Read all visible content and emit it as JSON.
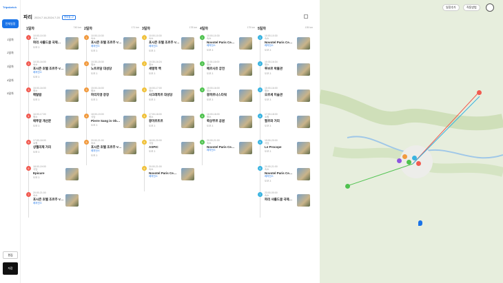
{
  "app": {
    "logo": "Tripsketch",
    "title": "파리",
    "dates": "2024.7.16-2024.7.20",
    "chip": "편의점 ⇄",
    "sidebar": [
      "전체일정",
      "1일차",
      "2일차",
      "3일차",
      "4일차",
      "5일차"
    ],
    "edit": "편집",
    "save": "저장"
  },
  "map": {
    "buttons": [
      "일정추가",
      "직동방법"
    ]
  },
  "days": [
    {
      "label": "1일차",
      "dist": "740 km",
      "stops": [
        {
          "n": "1",
          "color": "#f15a50",
          "time": "10:00-10:30",
          "cat": "숙소",
          "name": "파리 샤를드골 국제…",
          "sub": "",
          "next": "도보 3"
        },
        {
          "n": "2",
          "color": "#f15a50",
          "time": "10:30-16:00",
          "cat": "숙소",
          "name": "포시즌 호텔 조르주 V…",
          "sub": "레지던스",
          "next": "도보 3"
        },
        {
          "n": "3",
          "color": "#f15a50",
          "time": "15:00-16:00",
          "cat": "명소",
          "name": "메탈람",
          "sub": "",
          "next": "도보 3"
        },
        {
          "n": "4",
          "color": "#f15a50",
          "time": "16:00-17:00",
          "cat": "명소",
          "name": "에투알 개선문",
          "sub": "",
          "next": "도보 3"
        },
        {
          "n": "5",
          "color": "#f15a50",
          "time": "17:00-18:00",
          "cat": "쇼핑",
          "name": "샹젤리제 거리",
          "sub": "",
          "next": "도보 3"
        },
        {
          "n": "6",
          "color": "#f15a50",
          "time": "18:00-19:00",
          "cat": "식당",
          "name": "Epicure",
          "sub": "",
          "next": "도보 3"
        },
        {
          "n": "7",
          "color": "#f15a50",
          "time": "20:00-21:00",
          "cat": "숙소",
          "name": "포시즌 호텔 조르주 V…",
          "sub": "레지던스",
          "next": ""
        }
      ]
    },
    {
      "label": "2일차",
      "dist": "171 km",
      "stops": [
        {
          "n": "1",
          "color": "#f19a3e",
          "time": "10:00-10:30",
          "cat": "숙소",
          "name": "포시즌 호텔 조르주 V…",
          "sub": "레지던스",
          "next": "도보 3"
        },
        {
          "n": "2",
          "color": "#f19a3e",
          "time": "10:30-15:30",
          "cat": "명소",
          "name": "노트르담 대성당",
          "sub": "",
          "next": "도보 3"
        },
        {
          "n": "3",
          "color": "#f19a3e",
          "time": "15:00-16:00",
          "cat": "명소",
          "name": "파리지앵 광장",
          "sub": "",
          "next": "도보 3"
        },
        {
          "n": "4",
          "color": "#f19a3e",
          "time": "18:00-19:00",
          "cat": "식당",
          "name": "Pierre Sang in Ob…",
          "sub": "",
          "next": "도보 3"
        },
        {
          "n": "5",
          "color": "#f19a3e",
          "time": "20:00-21:00",
          "cat": "숙소",
          "name": "포시즌 호텔 조르주 V…",
          "sub": "레지던스",
          "next": "도보 3"
        }
      ]
    },
    {
      "label": "3일차",
      "dist": "178 km",
      "stops": [
        {
          "n": "1",
          "color": "#f0c13a",
          "time": "10:00-10:30",
          "cat": "숙소",
          "name": "포시즌 호텔 조르주 V…",
          "sub": "레지던스",
          "next": "도보 3"
        },
        {
          "n": "2",
          "color": "#f0c13a",
          "time": "10:30-16:24",
          "cat": "명소",
          "name": "세탱헉 백",
          "sub": "",
          "next": "도보 3"
        },
        {
          "n": "3",
          "color": "#f0c13a",
          "time": "16:00-17:00",
          "cat": "명소",
          "name": "사크레쾨르 대성당",
          "sub": "",
          "next": "도보 3"
        },
        {
          "n": "4",
          "color": "#f0c13a",
          "time": "17:00-18:00",
          "cat": "명소",
          "name": "몽마르트르",
          "sub": "",
          "next": "도보 3"
        },
        {
          "n": "5",
          "color": "#f0c13a",
          "time": "18:00-20:00",
          "cat": "식당",
          "name": "ASPIC",
          "sub": "",
          "next": "도보 3"
        },
        {
          "n": "6",
          "color": "#f0c13a",
          "time": "20:00-21:00",
          "cat": "숙소",
          "name": "Novotel Paris Ce…",
          "sub": "레지던스",
          "next": ""
        }
      ]
    },
    {
      "label": "4일차",
      "dist": "175 km",
      "stops": [
        {
          "n": "1",
          "color": "#4fc24f",
          "time": "10:00-10:30",
          "cat": "숙소",
          "name": "Novotel Paris Ce…",
          "sub": "레지던스",
          "next": "도보 3"
        },
        {
          "n": "2",
          "color": "#4fc24f",
          "time": "11:00-16:00",
          "cat": "명소",
          "name": "베르사유 궁전",
          "sub": "",
          "next": "도보 3"
        },
        {
          "n": "3",
          "color": "#4fc24f",
          "time": "15:00-16:00",
          "cat": "명소",
          "name": "몽파르나스타워",
          "sub": "",
          "next": "도보 3"
        },
        {
          "n": "4",
          "color": "#4fc24f",
          "time": "16:00-18:00",
          "cat": "명소",
          "name": "뤽상부르 공원",
          "sub": "",
          "next": "도보 3"
        },
        {
          "n": "5",
          "color": "#4fc24f",
          "time": "20:00-21:00",
          "cat": "숙소",
          "name": "Novotel Paris Ce…",
          "sub": "레지던스",
          "next": ""
        }
      ]
    },
    {
      "label": "5일차",
      "dist": "135 km",
      "stops": [
        {
          "n": "1",
          "color": "#39b3e0",
          "time": "10:00-10:30",
          "cat": "숙소",
          "name": "Novotel Paris Ce…",
          "sub": "레지던스",
          "next": "도보 3"
        },
        {
          "n": "2",
          "color": "#39b3e0",
          "time": "10:30-16:34",
          "cat": "명소",
          "name": "루브르 박물관",
          "sub": "",
          "next": "도보 3"
        },
        {
          "n": "3",
          "color": "#39b3e0",
          "time": "15:00-16:00",
          "cat": "명소",
          "name": "오르세 미술관",
          "sub": "",
          "next": "도보 3"
        },
        {
          "n": "4",
          "color": "#39b3e0",
          "time": "17:00-18:00",
          "cat": "쇼핑",
          "name": "팔르와 거리",
          "sub": "",
          "next": "도보 3"
        },
        {
          "n": "5",
          "color": "#39b3e0",
          "time": "19:00-20:00",
          "cat": "식당",
          "name": "Le Procope",
          "sub": "",
          "next": "도보 3"
        },
        {
          "n": "6",
          "color": "#39b3e0",
          "time": "20:00-21:00",
          "cat": "숙소",
          "name": "Novotel Paris Ce…",
          "sub": "레지던스",
          "next": "도보 3"
        },
        {
          "n": "7",
          "color": "#39b3e0",
          "time": "23:00-00:00",
          "cat": "숙소",
          "name": "파리 샤를드골 국제…",
          "sub": "",
          "next": ""
        }
      ]
    }
  ]
}
